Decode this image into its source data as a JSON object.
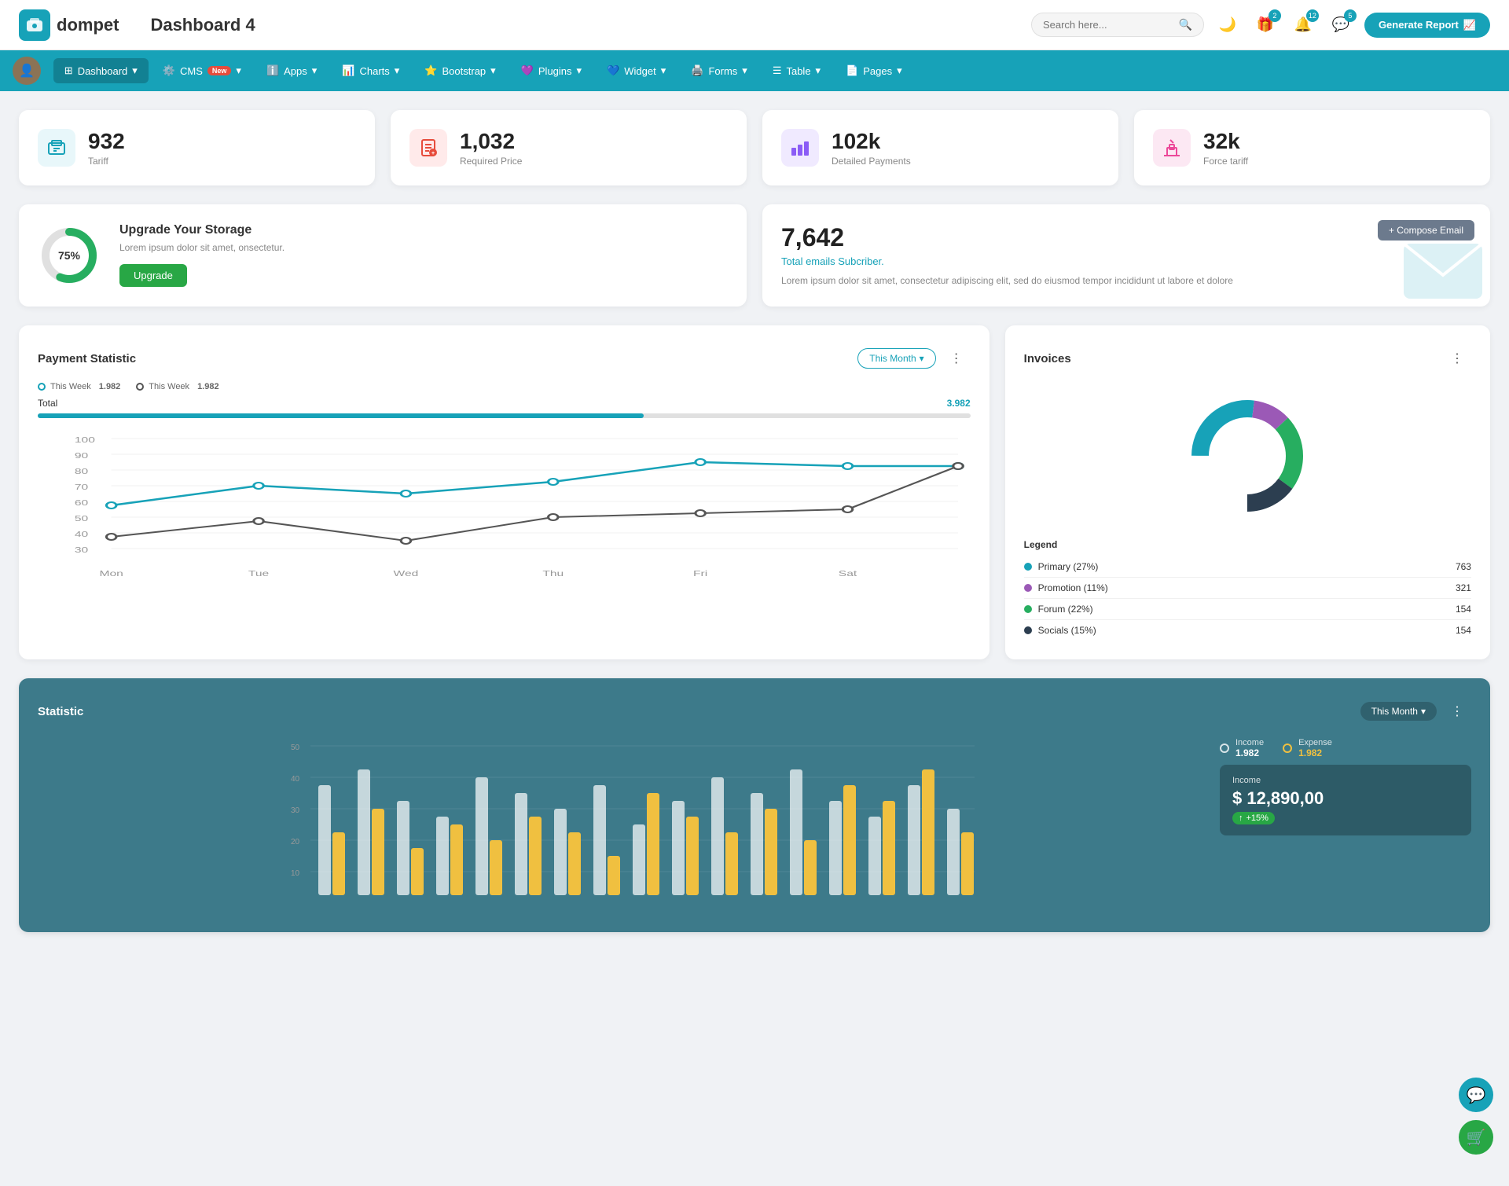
{
  "header": {
    "logo_text": "dompet",
    "page_title": "Dashboard 4",
    "search_placeholder": "Search here...",
    "generate_btn": "Generate Report"
  },
  "header_icons": {
    "moon_icon": "🌙",
    "gift_icon": "🎁",
    "bell_badge": "12",
    "chat_badge": "5",
    "gift_badge": "2"
  },
  "nav": {
    "items": [
      {
        "label": "Dashboard",
        "active": true
      },
      {
        "label": "CMS",
        "badge": "New"
      },
      {
        "label": "Apps"
      },
      {
        "label": "Charts"
      },
      {
        "label": "Bootstrap"
      },
      {
        "label": "Plugins"
      },
      {
        "label": "Widget"
      },
      {
        "label": "Forms"
      },
      {
        "label": "Table"
      },
      {
        "label": "Pages"
      }
    ]
  },
  "stat_cards": [
    {
      "value": "932",
      "label": "Tariff",
      "icon": "🧳",
      "color": "#17a2b8"
    },
    {
      "value": "1,032",
      "label": "Required Price",
      "icon": "📋",
      "color": "#e74c3c"
    },
    {
      "value": "102k",
      "label": "Detailed Payments",
      "icon": "📊",
      "color": "#8b5cf6"
    },
    {
      "value": "32k",
      "label": "Force tariff",
      "icon": "🏗️",
      "color": "#ec4899"
    }
  ],
  "storage": {
    "percent": "75%",
    "title": "Upgrade Your Storage",
    "description": "Lorem ipsum dolor sit amet, onsectetur.",
    "btn_label": "Upgrade"
  },
  "email": {
    "count": "7,642",
    "subtitle": "Total emails Subcriber.",
    "description": "Lorem ipsum dolor sit amet, consectetur adipiscing elit, sed do eiusmod tempor incididunt ut labore et dolore",
    "compose_btn": "+ Compose Email"
  },
  "payment": {
    "title": "Payment Statistic",
    "this_month_label": "This Month",
    "legend": [
      {
        "label": "This Week",
        "value": "1.982",
        "color": "#17a2b8"
      },
      {
        "label": "This Week",
        "value": "1.982",
        "color": "#555"
      }
    ],
    "total_label": "Total",
    "total_value": "3.982",
    "x_labels": [
      "Mon",
      "Tue",
      "Wed",
      "Thu",
      "Fri",
      "Sat"
    ],
    "y_labels": [
      "100",
      "90",
      "80",
      "70",
      "60",
      "50",
      "40",
      "30"
    ]
  },
  "invoices": {
    "title": "Invoices",
    "legend": [
      {
        "label": "Primary (27%)",
        "value": "763",
        "color": "#17a2b8"
      },
      {
        "label": "Promotion (11%)",
        "value": "321",
        "color": "#9b59b6"
      },
      {
        "label": "Forum (22%)",
        "value": "154",
        "color": "#27ae60"
      },
      {
        "label": "Socials (15%)",
        "value": "154",
        "color": "#2c3e50"
      }
    ],
    "legend_title": "Legend"
  },
  "statistic": {
    "title": "Statistic",
    "this_month_label": "This Month",
    "income_label": "Income",
    "income_value": "1.982",
    "expense_label": "Expense",
    "expense_value": "1.982",
    "income_amount": "$ 12,890,00",
    "income_badge": "+15%",
    "income_box_label": "Income",
    "y_labels": [
      "50",
      "40",
      "30",
      "20",
      "10"
    ]
  }
}
